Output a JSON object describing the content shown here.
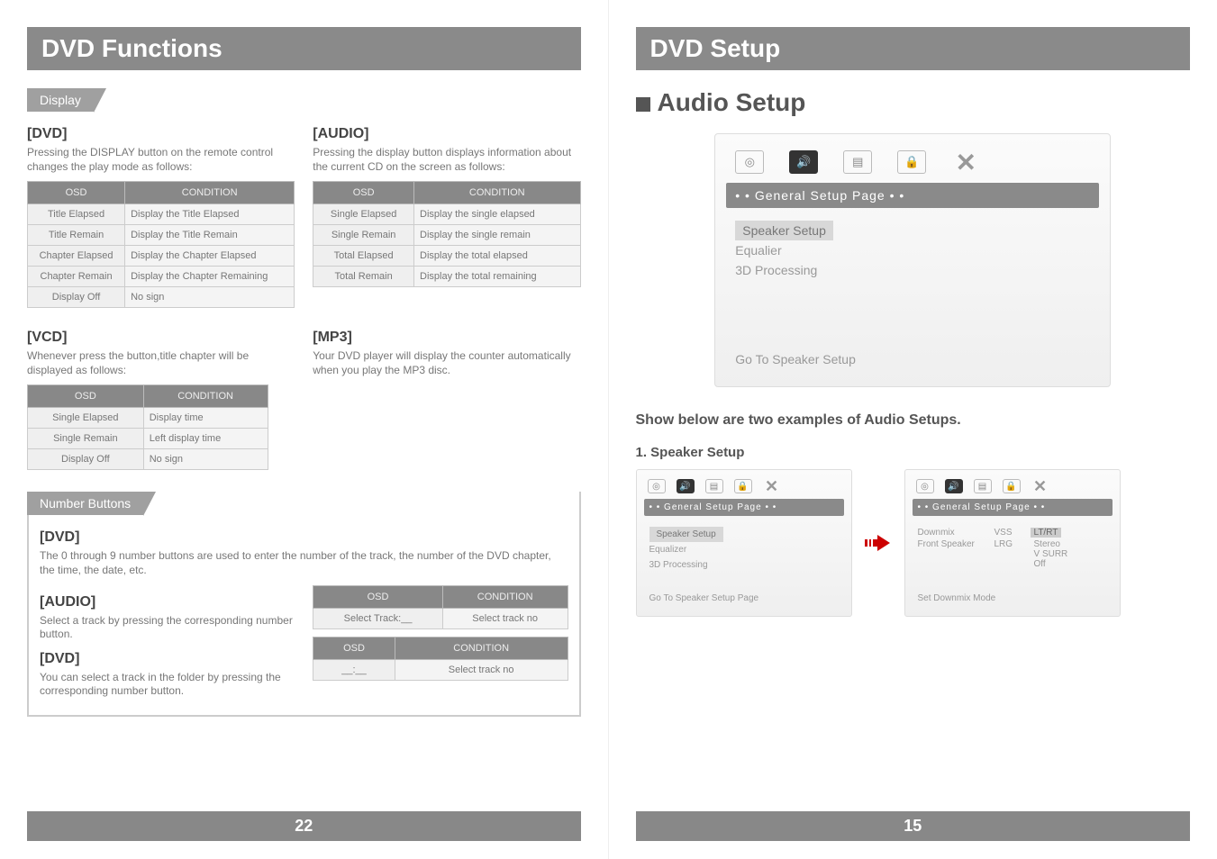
{
  "left": {
    "title": "DVD Functions",
    "display_tag": "Display",
    "dvd": {
      "heading": "[DVD]",
      "text": "Pressing the DISPLAY button on the remote control changes the play mode as follows:",
      "th_osd": "OSD",
      "th_cond": "CONDITION",
      "rows": [
        {
          "osd": "Title Elapsed",
          "cond": "Display the Title Elapsed"
        },
        {
          "osd": "Title Remain",
          "cond": "Display the Title Remain"
        },
        {
          "osd": "Chapter Elapsed",
          "cond": "Display the Chapter Elapsed"
        },
        {
          "osd": "Chapter Remain",
          "cond": "Display the Chapter Remaining"
        },
        {
          "osd": "Display Off",
          "cond": "No sign"
        }
      ]
    },
    "audio": {
      "heading": "[AUDIO]",
      "text": "Pressing the display button displays information about the current CD on the screen as follows:",
      "th_osd": "OSD",
      "th_cond": "CONDITION",
      "rows": [
        {
          "osd": "Single Elapsed",
          "cond": "Display the single elapsed"
        },
        {
          "osd": "Single Remain",
          "cond": "Display the single remain"
        },
        {
          "osd": "Total Elapsed",
          "cond": "Display the total elapsed"
        },
        {
          "osd": "Total Remain",
          "cond": "Display the total remaining"
        }
      ]
    },
    "vcd": {
      "heading": "[VCD]",
      "text": "Whenever press the button,title chapter will be displayed as follows:",
      "th_osd": "OSD",
      "th_cond": "CONDITION",
      "rows": [
        {
          "osd": "Single Elapsed",
          "cond": "Display time"
        },
        {
          "osd": "Single Remain",
          "cond": "Left display time"
        },
        {
          "osd": "Display Off",
          "cond": "No sign"
        }
      ]
    },
    "mp3": {
      "heading": "[MP3]",
      "text": "Your DVD player will display the counter automatically when you play the MP3 disc."
    },
    "numbers": {
      "tag": "Number Buttons",
      "dvd_h": "[DVD]",
      "dvd_t": "The 0 through 9 number buttons are used to enter the number of the track, the number of the DVD chapter, the time, the date, etc.",
      "audio_h": "[AUDIO]",
      "audio_t": "Select a track by pressing the corresponding number button.",
      "dvd2_h": "[DVD]",
      "dvd2_t": "You can select a track in the folder by pressing the corresponding number button.",
      "tbl1": {
        "th_osd": "OSD",
        "th_cond": "CONDITION",
        "osd": "Select Track:__",
        "cond": "Select track no"
      },
      "tbl2": {
        "th_osd": "OSD",
        "th_cond": "CONDITION",
        "osd": "__:__",
        "cond": "Select track no"
      }
    },
    "page_num": "22"
  },
  "right": {
    "title": "DVD Setup",
    "big_heading": "Audio Setup",
    "menu": {
      "bar": "• • General Setup Page • •",
      "items": [
        {
          "label": "Speaker Setup",
          "hi": true
        },
        {
          "label": "Equalier",
          "hi": false
        },
        {
          "label": "3D Processing",
          "hi": false
        }
      ],
      "footer": "Go To Speaker Setup"
    },
    "caption": "Show below are two examples of Audio Setups.",
    "example1_title": "1. Speaker Setup",
    "shot_a": {
      "bar": "• • General Setup Page • •",
      "items": [
        {
          "label": "Speaker Setup",
          "hi": true
        },
        {
          "label": "Equalizer",
          "hi": false
        },
        {
          "label": "3D Processing",
          "hi": false
        }
      ],
      "footer": "Go To Speaker Setup Page"
    },
    "shot_b": {
      "bar": "• • General Setup Page • •",
      "rows": [
        {
          "name": "Downmix",
          "val": "VSS",
          "choices": [
            "LT/RT"
          ],
          "hi": 0
        },
        {
          "name": "Front Speaker",
          "val": "LRG",
          "choices": [
            "Stereo",
            "V SURR",
            "Off"
          ],
          "hi": -1
        }
      ],
      "footer": "Set Downmix Mode"
    },
    "page_num": "15"
  },
  "icons": {
    "disc": "◎",
    "speaker": "🔊",
    "osd": "▤",
    "lock": "🔒",
    "x": "✕"
  }
}
